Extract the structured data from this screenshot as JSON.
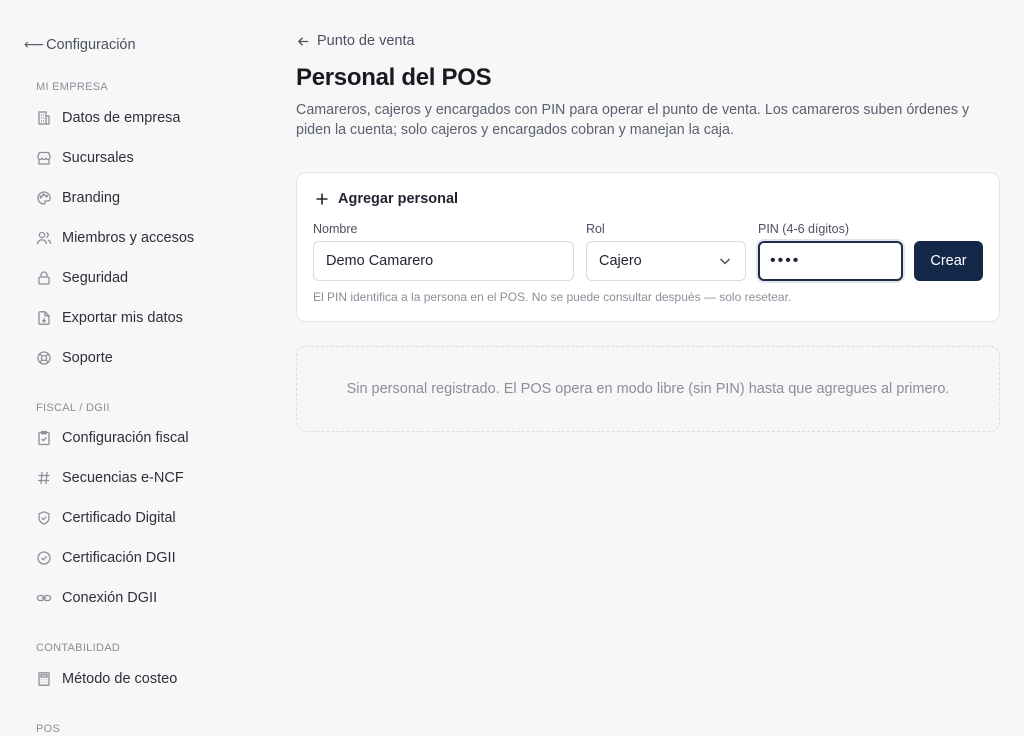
{
  "sidebar": {
    "back_label": "Configuración",
    "sections": {
      "mi_empresa": "MI EMPRESA",
      "fiscal": "FISCAL / DGII",
      "contabilidad": "CONTABILIDAD",
      "pos": "POS"
    },
    "items": [
      {
        "label": "Datos de empresa",
        "icon": "building-icon"
      },
      {
        "label": "Sucursales",
        "icon": "store-icon"
      },
      {
        "label": "Branding",
        "icon": "palette-icon"
      },
      {
        "label": "Miembros y accesos",
        "icon": "users-icon"
      },
      {
        "label": "Seguridad",
        "icon": "lock-icon"
      },
      {
        "label": "Exportar mis datos",
        "icon": "file-export-icon"
      },
      {
        "label": "Soporte",
        "icon": "lifebuoy-icon"
      },
      {
        "label": "Configuración fiscal",
        "icon": "clipboard-check-icon"
      },
      {
        "label": "Secuencias e-NCF",
        "icon": "hash-icon"
      },
      {
        "label": "Certificado Digital",
        "icon": "shield-check-icon"
      },
      {
        "label": "Certificación DGII",
        "icon": "badge-check-icon"
      },
      {
        "label": "Conexión DGII",
        "icon": "link-icon"
      },
      {
        "label": "Método de costeo",
        "icon": "calculator-icon"
      }
    ]
  },
  "main": {
    "breadcrumb": "Punto de venta",
    "title": "Personal del POS",
    "description": "Camareros, cajeros y encargados con PIN para operar el punto de venta. Los camareros suben órdenes y piden la cuenta; solo cajeros y encargados cobran y manejan la caja.",
    "form": {
      "heading": "Agregar personal",
      "name_label": "Nombre",
      "name_value": "Demo Camarero",
      "role_label": "Rol",
      "role_value": "Cajero",
      "pin_label": "PIN (4-6 dígitos)",
      "pin_value": "••••",
      "create_label": "Crear",
      "hint": "El PIN identifica a la persona en el POS. No se puede consultar después — solo resetear."
    },
    "empty_message": "Sin personal registrado. El POS opera en modo libre (sin PIN) hasta que agregues al primero."
  },
  "colors": {
    "primary": "#142849",
    "text": "#1f2430",
    "muted": "#8a8f99",
    "border": "#e4e6ea",
    "background": "#f7f7f8"
  }
}
